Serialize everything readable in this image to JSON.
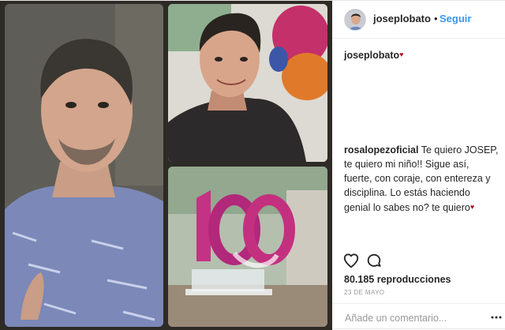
{
  "post": {
    "media": {
      "panels": [
        "portrait-man-blue-shirt",
        "selfie-young-man",
        "trophy-100-logo"
      ]
    },
    "header": {
      "username": "joseplobato",
      "separator": "•",
      "follow_label": "Seguir"
    },
    "caption": {
      "username": "joseplobato",
      "emoji": "heart"
    },
    "comment": {
      "username": "rosalopezoficial",
      "text": "Te quiero JOSEP, te quiero mi niño!! Sigue así, fuerte, con coraje, con entereza y disciplina. Lo estás haciendo genial lo sabes no? te quiero",
      "emoji": "heart"
    },
    "actions": {
      "like_icon": "heart-outline-icon",
      "comment_icon": "speech-bubble-icon"
    },
    "views": "80.185 reproducciones",
    "date": "23 DE MAYO",
    "add_comment": {
      "placeholder": "Añade un comentario...",
      "more_icon": "ellipsis-icon"
    },
    "colors": {
      "link": "#3897f0",
      "heart_emoji": "#b0152d",
      "text": "#262626",
      "muted": "#999999"
    }
  }
}
